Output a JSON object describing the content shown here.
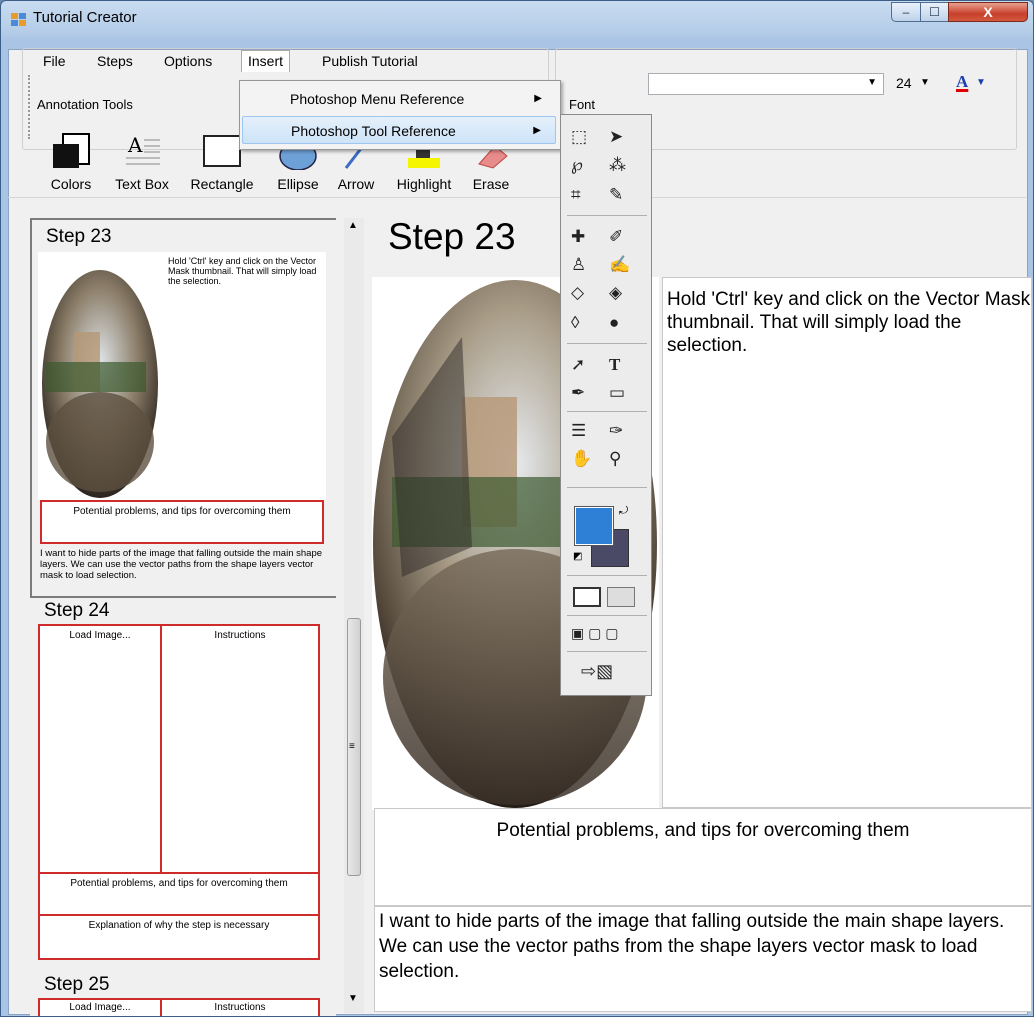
{
  "window": {
    "title": "Tutorial Creator",
    "min": "–",
    "max": "☐",
    "close": "X"
  },
  "menu": {
    "file": "File",
    "steps": "Steps",
    "options": "Options",
    "insert": "Insert",
    "publish": "Publish Tutorial"
  },
  "insert_menu": {
    "item1": "Photoshop Menu Reference",
    "item2": "Photoshop Tool Reference",
    "arrow": "▶"
  },
  "annotation_tools": {
    "group_label": "Annotation Tools",
    "tools": [
      "Colors",
      "Text Box",
      "Rectangle",
      "Ellipse",
      "Arrow",
      "Highlight",
      "Erase"
    ]
  },
  "font_group": {
    "label": "Font",
    "font_name": "",
    "size": "24",
    "color_glyph": "A"
  },
  "steps_panel": {
    "step23": {
      "title": "Step 23",
      "text": "Hold 'Ctrl' key and click on the Vector Mask thumbnail. That will simply load the selection.",
      "problems": "Potential problems, and tips for overcoming them",
      "explain": "I want to hide parts of the image that falling outside the main shape layers. We can use the vector paths from the shape layers vector mask to load selection."
    },
    "step24": {
      "title": "Step 24",
      "load_image": "Load Image...",
      "instructions": "Instructions",
      "problems": "Potential problems, and tips for overcoming them",
      "explain": "Explanation of why the step is necessary"
    },
    "step25": {
      "title": "Step 25",
      "load_image": "Load Image...",
      "instructions": "Instructions"
    }
  },
  "main": {
    "title": "Step 23",
    "text": "Hold 'Ctrl' key and click on the Vector Mask thumbnail. That will simply load the selection.",
    "problems": "Potential problems, and tips for overcoming them",
    "explain": "I want to hide parts of the image that falling outside the main shape layers. We can use the vector paths from the shape layers vector mask to load selection."
  },
  "colors": {
    "foreground": "#2e7fd6",
    "background": "#4a4a66",
    "accent_red": "#cf2b2b"
  }
}
